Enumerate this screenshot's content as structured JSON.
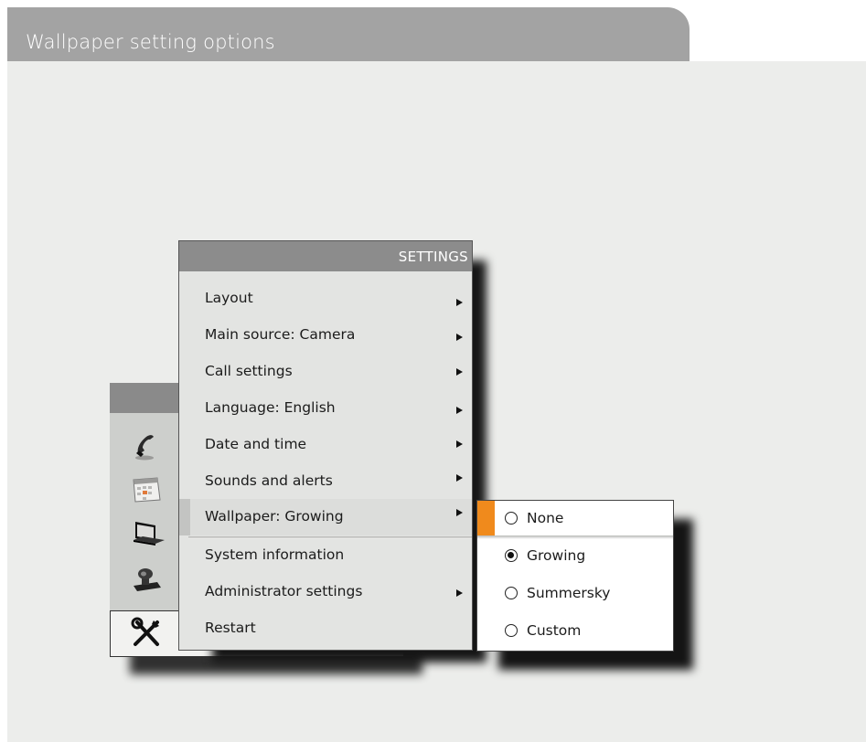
{
  "page": {
    "title": "Wallpaper setting options"
  },
  "settings_menu": {
    "header": "SETTINGS",
    "items": [
      {
        "label": "Layout",
        "has_submenu": true
      },
      {
        "label": "Main source: Camera",
        "has_submenu": true
      },
      {
        "label": "Call settings",
        "has_submenu": true
      },
      {
        "label": "Language: English",
        "has_submenu": true
      },
      {
        "label": "Date and time",
        "has_submenu": true
      },
      {
        "label": "Sounds and alerts",
        "has_submenu": true
      },
      {
        "label": "Wallpaper: Growing",
        "has_submenu": true,
        "active": true
      },
      {
        "label": "System information",
        "has_submenu": false
      },
      {
        "label": "Administrator settings",
        "has_submenu": true
      },
      {
        "label": "Restart",
        "has_submenu": false
      }
    ]
  },
  "wallpaper_submenu": {
    "options": [
      {
        "label": "None",
        "selected": false,
        "highlighted": true
      },
      {
        "label": "Growing",
        "selected": true,
        "highlighted": false
      },
      {
        "label": "Summersky",
        "selected": false,
        "highlighted": false
      },
      {
        "label": "Custom",
        "selected": false,
        "highlighted": false
      }
    ]
  },
  "home_icons": [
    "phone-icon",
    "calendar-icon",
    "laptop-icon",
    "camera-icon",
    "tools-icon"
  ],
  "colors": {
    "accent": "#f08a1c",
    "header": "#8c8c8c",
    "title_tab": "#a3a3a3",
    "background": "#ecedeb"
  }
}
